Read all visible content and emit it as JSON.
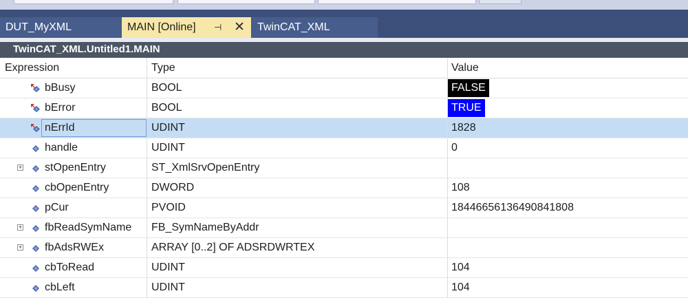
{
  "tabs": [
    {
      "label": "DUT_MyXML",
      "active": false
    },
    {
      "label": "MAIN [Online]",
      "active": true,
      "pin_icon": "pin-icon",
      "close_icon": "close-icon"
    },
    {
      "label": "TwinCAT_XML",
      "active": false
    }
  ],
  "window_title": "TwinCAT_XML.Untitled1.MAIN",
  "columns": {
    "expression": "Expression",
    "type": "Type",
    "value": "Value"
  },
  "rows": [
    {
      "expression": "bBusy",
      "type": "BOOL",
      "value": "FALSE",
      "icon": "output-variable-icon",
      "expandable": false,
      "value_style": "false-highlight"
    },
    {
      "expression": "bError",
      "type": "BOOL",
      "value": "TRUE",
      "icon": "output-variable-icon",
      "expandable": false,
      "value_style": "true-highlight"
    },
    {
      "expression": "nErrId",
      "type": "UDINT",
      "value": "1828",
      "icon": "output-variable-icon",
      "expandable": false,
      "selected": true
    },
    {
      "expression": "handle",
      "type": "UDINT",
      "value": "0",
      "icon": "variable-icon",
      "expandable": false
    },
    {
      "expression": "stOpenEntry",
      "type": "ST_XmlSrvOpenEntry",
      "value": "",
      "icon": "variable-icon",
      "expandable": true
    },
    {
      "expression": "cbOpenEntry",
      "type": "DWORD",
      "value": "108",
      "icon": "variable-icon",
      "expandable": false
    },
    {
      "expression": "pCur",
      "type": "PVOID",
      "value": "18446656136490841808",
      "icon": "variable-icon",
      "expandable": false
    },
    {
      "expression": "fbReadSymName",
      "type": "FB_SymNameByAddr",
      "value": "",
      "icon": "variable-icon",
      "expandable": true
    },
    {
      "expression": "fbAdsRWEx",
      "type": "ARRAY [0..2] OF ADSRDWRTEX",
      "value": "",
      "icon": "variable-icon",
      "expandable": true
    },
    {
      "expression": "cbToRead",
      "type": "UDINT",
      "value": "104",
      "icon": "variable-icon",
      "expandable": false
    },
    {
      "expression": "cbLeft",
      "type": "UDINT",
      "value": "104",
      "icon": "variable-icon",
      "expandable": false
    }
  ],
  "colors": {
    "tab_strip": "#3c4f7a",
    "active_tab": "#f7e7a9",
    "selected_row": "#c5ddf4",
    "false_highlight_bg": "#000000",
    "true_highlight_bg": "#0000ff"
  }
}
